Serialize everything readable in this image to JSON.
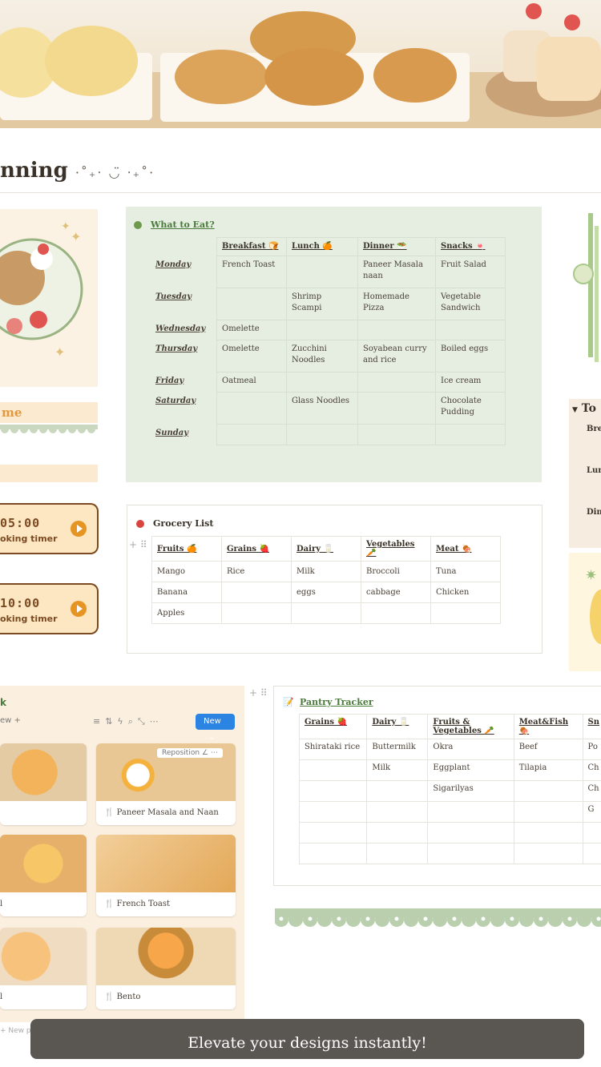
{
  "page": {
    "title": "nning",
    "title_deco": "·˚₊‧ ◡̈ ‧₊˚·"
  },
  "left": {
    "welcome": "me",
    "timers": [
      {
        "time": "05:00",
        "label": "oking timer"
      },
      {
        "time": "10:00",
        "label": "oking timer"
      }
    ]
  },
  "what_to_eat": {
    "title": "What to Eat?",
    "columns": [
      "Breakfast 🍞",
      "Lunch 🍊",
      "Dinner 🥗",
      "Snacks 🍬"
    ],
    "rows": [
      {
        "day": "Monday",
        "cells": [
          "French Toast",
          "",
          "Paneer Masala naan",
          "Fruit Salad"
        ]
      },
      {
        "day": "Tuesday",
        "cells": [
          "",
          "Shrimp Scampi",
          "Homemade Pizza",
          "Vegetable Sandwich"
        ]
      },
      {
        "day": "Wednesday",
        "cells": [
          "Omelette",
          "",
          "",
          ""
        ]
      },
      {
        "day": "Thursday",
        "cells": [
          "Omelette",
          "Zucchini Noodles",
          "Soyabean curry and rice",
          "Boiled eggs"
        ]
      },
      {
        "day": "Friday",
        "cells": [
          "Oatmeal",
          "",
          "",
          "Ice cream"
        ]
      },
      {
        "day": "Saturday",
        "cells": [
          "",
          "Glass Noodles",
          "",
          "Chocolate Pudding"
        ]
      },
      {
        "day": "Sunday",
        "cells": [
          "",
          "",
          "",
          ""
        ]
      }
    ]
  },
  "grocery": {
    "title": "Grocery List",
    "columns": [
      "Fruits 🍊",
      "Grains 🍓",
      "Dairy 🥛",
      "Vegetables 🥕",
      "Meat 🍖"
    ],
    "rows": [
      [
        "Mango",
        "Rice",
        "Milk",
        "Broccoli",
        "Tuna"
      ],
      [
        "Banana",
        "",
        "eggs",
        "cabbage",
        "Chicken"
      ],
      [
        "Apples",
        "",
        "",
        "",
        ""
      ]
    ]
  },
  "recipes": {
    "view_label": "ew",
    "new_label": "New",
    "cards": [
      {
        "caption": ""
      },
      {
        "caption": "Paneer Masala and Naan",
        "reposition": "Reposition"
      },
      {
        "caption": "l"
      },
      {
        "caption": "French Toast"
      },
      {
        "caption": "l"
      },
      {
        "caption": "Bento"
      }
    ],
    "new_page": "New p"
  },
  "pantry": {
    "title": "Pantry Tracker",
    "columns": [
      "Grains 🍓",
      "Dairy 🥛",
      "Fruits & Vegetables 🥕",
      "Meat&Fish 🍖",
      "Sn"
    ],
    "rows": [
      [
        "Shirataki rice",
        "Buttermilk",
        "Okra",
        "Beef",
        "Po"
      ],
      [
        "",
        "Milk",
        "Eggplant",
        "Tilapia",
        "Ch"
      ],
      [
        "",
        "",
        "Sigarilyas",
        "",
        "Ch"
      ],
      [
        "",
        "",
        "",
        "",
        "G"
      ],
      [
        "",
        "",
        "",
        "",
        ""
      ],
      [
        "",
        "",
        "",
        "",
        ""
      ]
    ]
  },
  "right": {
    "toggle_title": "To",
    "items": [
      "Bre",
      "Lun",
      "Din"
    ]
  },
  "toast": {
    "text": "Elevate your designs instantly!"
  },
  "colors": {
    "accent_green": "#4a7a3c",
    "button_blue": "#2b83e2",
    "timer_orange": "#e69523",
    "toast_bg": "#5a5652"
  }
}
